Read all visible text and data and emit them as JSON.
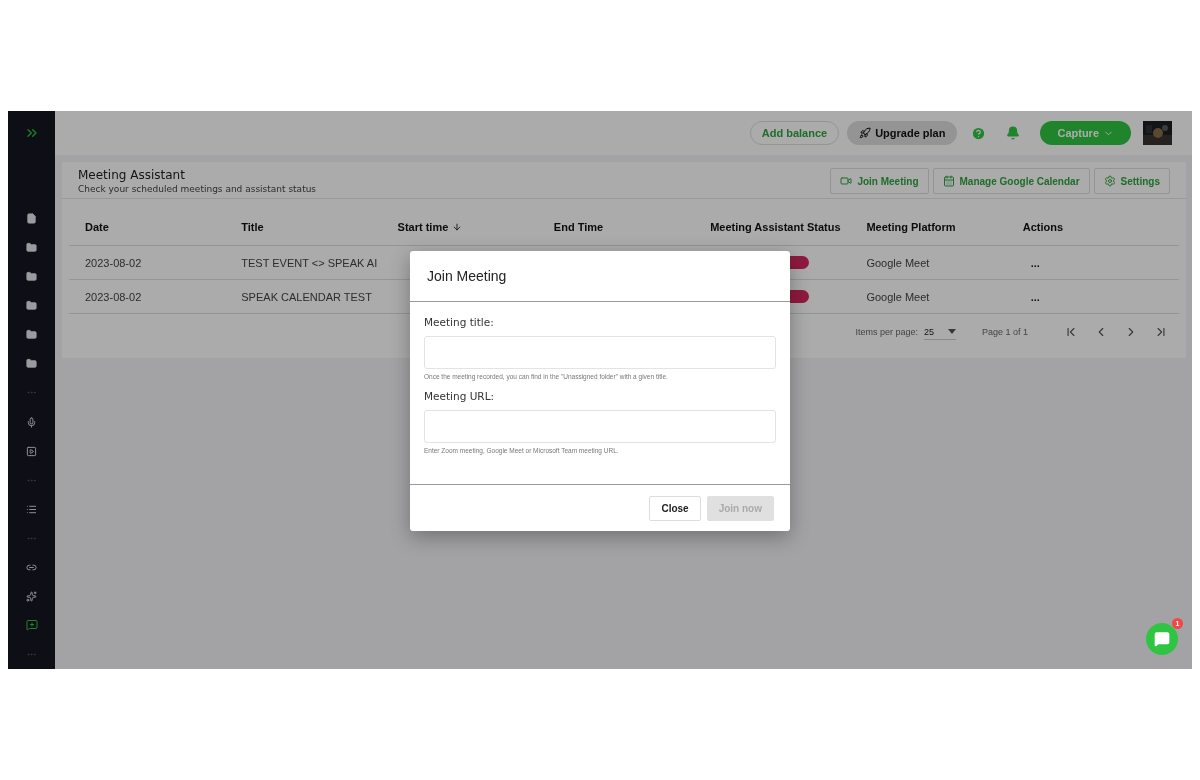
{
  "topbar": {
    "buttons": [
      {
        "kind": "outline",
        "label": "Add balance"
      },
      {
        "kind": "upgrade",
        "label": "Upgrade plan"
      },
      {
        "kind": "capture",
        "label": "Capture"
      }
    ]
  },
  "sidebar": {
    "items": [
      {
        "kind": "file"
      },
      {
        "kind": "folder"
      },
      {
        "kind": "folder"
      },
      {
        "kind": "folder"
      },
      {
        "kind": "folder"
      },
      {
        "kind": "folder"
      },
      {
        "kind": "dots"
      },
      {
        "kind": "mic"
      },
      {
        "kind": "video"
      },
      {
        "kind": "dots"
      },
      {
        "kind": "list"
      },
      {
        "kind": "dots"
      },
      {
        "kind": "link"
      },
      {
        "kind": "sparkle"
      },
      {
        "kind": "add"
      },
      {
        "kind": "dots"
      }
    ]
  },
  "page": {
    "title": "Meeting Assistant",
    "subtitle": "Check your scheduled meetings and assistant status",
    "actions": [
      {
        "kind": "join",
        "label": "Join Meeting"
      },
      {
        "kind": "calendar",
        "label": "Manage Google Calendar"
      },
      {
        "kind": "settings",
        "label": "Settings"
      }
    ]
  },
  "table": {
    "columns": [
      {
        "label": "Date",
        "sorted": false
      },
      {
        "label": "Title",
        "sorted": false
      },
      {
        "label": "Start time",
        "sorted": true
      },
      {
        "label": "End Time",
        "sorted": false
      },
      {
        "label": "Meeting Assistant Status",
        "sorted": false
      },
      {
        "label": "Meeting Platform",
        "sorted": false
      },
      {
        "label": "Actions",
        "sorted": false
      }
    ],
    "rows": [
      {
        "date": "2023-08-02",
        "title": "TEST EVENT <> SPEAK AI",
        "platform": "Google Meet",
        "actions": "..."
      },
      {
        "date": "2023-08-02",
        "title": "SPEAK CALENDAR TEST",
        "platform": "Google Meet",
        "actions": "..."
      }
    ]
  },
  "pagination": {
    "items_per_page_label": "Items per page:",
    "items_per_page": "25",
    "page_info": "Page 1 of 1"
  },
  "dialog": {
    "title": "Join Meeting",
    "fields": [
      {
        "label": "Meeting title:",
        "hint": "Once the meeting recorded, you can find in the \"Unassigned folder\" with a given title."
      },
      {
        "label": "Meeting URL:",
        "hint": "Enter Zoom meeting, Google Meet or Microsoft Team meeting URL."
      }
    ],
    "buttons": [
      {
        "label": "Close",
        "disabled": false
      },
      {
        "label": "Join now",
        "disabled": true
      }
    ]
  },
  "chat": {
    "badge": "1"
  }
}
